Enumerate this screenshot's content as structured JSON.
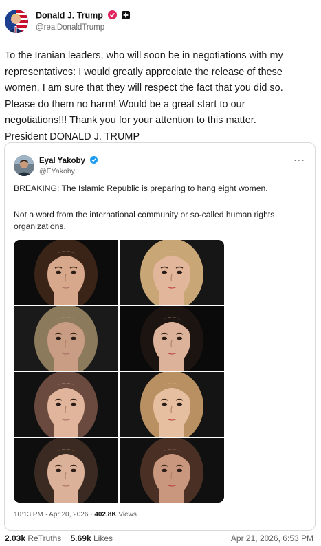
{
  "post": {
    "author_name": "Donald J. Trump",
    "author_handle": "@realDonaldTrump",
    "text": "To the Iranian leaders, who will soon be in negotiations with my\nrepresentatives: I would greatly appreciate the release of these\nwomen. I am sure that they will respect the fact that you did so.\nPlease do them no harm! Would be a great start to our\nnegotiations!!! Thank you for your attention to this matter.\nPresident DONALD J. TRUMP"
  },
  "quote": {
    "author_name": "Eyal Yakoby",
    "author_handle": "@EYakoby",
    "more_label": "···",
    "line1": "BREAKING: The Islamic Republic is preparing to hang eight women.",
    "line2": "Not a word from the international community or so-called human rights organizations.",
    "time": "10:13 PM",
    "date": "Apr 20, 2026",
    "views_count": "402.8K",
    "views_label": "Views"
  },
  "stats": {
    "retruths_count": "2.03k",
    "retruths_label": "ReTruths",
    "likes_count": "5.69k",
    "likes_label": "Likes",
    "timestamp": "Apr 21, 2026, 6:53 PM"
  },
  "colors": {
    "verified_badge": "#e0245e",
    "quote_verified_badge": "#1d9bf0"
  },
  "photos": [
    {
      "hair": "#3a2418",
      "skin": "#d7a88b",
      "bg": "#0c0c0c"
    },
    {
      "hair": "#c9a676",
      "skin": "#e2b69a",
      "bg": "#161616"
    },
    {
      "hair": "#8c7a5c",
      "skin": "#c99c84",
      "bg": "#1a1a1a"
    },
    {
      "hair": "#1c1410",
      "skin": "#dcb39a",
      "bg": "#0a0a0a"
    },
    {
      "hair": "#6a4a3e",
      "skin": "#e0b59c",
      "bg": "#111111"
    },
    {
      "hair": "#b89062",
      "skin": "#e6bea0",
      "bg": "#141414"
    },
    {
      "hair": "#3a2a22",
      "skin": "#dcb19a",
      "bg": "#0e0e0e"
    },
    {
      "hair": "#4a3024",
      "skin": "#c8977e",
      "bg": "#101010"
    }
  ]
}
